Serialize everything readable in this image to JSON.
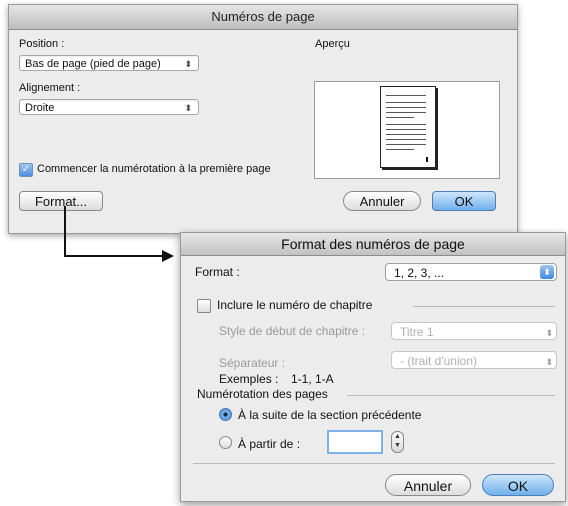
{
  "dialog1": {
    "title": "Numéros de page",
    "position_label": "Position :",
    "position_value": "Bas de page (pied de page)",
    "alignment_label": "Alignement :",
    "alignment_value": "Droite",
    "preview_label": "Aperçu",
    "start_numbering_label": "Commencer la numérotation à la première page",
    "start_numbering_checked": true,
    "format_button": "Format...",
    "cancel_button": "Annuler",
    "ok_button": "OK"
  },
  "dialog2": {
    "title": "Format des numéros de page",
    "format_label": "Format :",
    "format_value": "1, 2, 3, ...",
    "include_chapter_label": "Inclure le numéro de chapitre",
    "include_chapter_checked": false,
    "chapter_style_label": "Style de début de chapitre :",
    "chapter_style_value": "Titre 1",
    "separator_label": "Séparateur :",
    "separator_value": "-    (trait d'union)",
    "examples_label": "Exemples :",
    "examples_value": "1-1, 1-A",
    "page_numbering_label": "Numérotation des pages",
    "continue_label": "À la suite de la section précédente",
    "continue_selected": true,
    "start_at_label": "À partir de :",
    "start_at_value": "",
    "cancel_button": "Annuler",
    "ok_button": "OK"
  },
  "icons": {
    "popup_arrows": "up-down-arrows-icon",
    "checkmark": "checkmark-icon",
    "page_preview": "page-preview-icon",
    "connector_arrow": "arrow-right-icon"
  },
  "colors": {
    "accent": "#4a8de0",
    "dialog_bg": "#ececec"
  }
}
